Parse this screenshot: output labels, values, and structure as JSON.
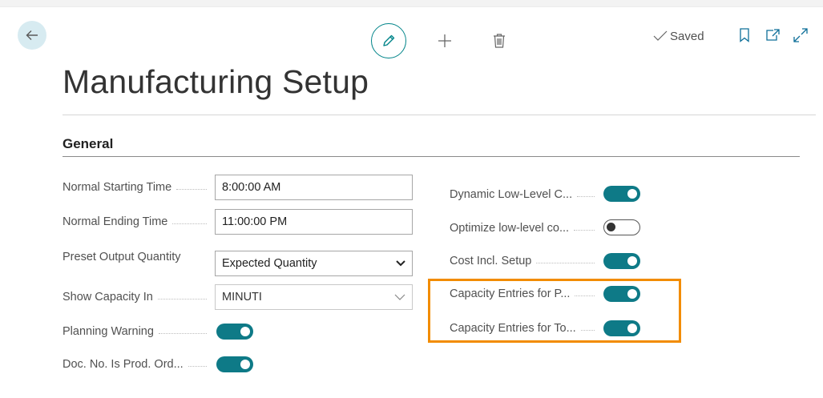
{
  "toolbar": {
    "saved_label": "Saved"
  },
  "page": {
    "title": "Manufacturing Setup"
  },
  "section": {
    "title": "General"
  },
  "left_fields": {
    "normal_starting_time": {
      "label": "Normal Starting Time",
      "value": "8:00:00 AM"
    },
    "normal_ending_time": {
      "label": "Normal Ending Time",
      "value": "11:00:00 PM"
    },
    "preset_output_quantity": {
      "label": "Preset Output Quantity",
      "value": "Expected Quantity"
    },
    "show_capacity_in": {
      "label": "Show Capacity In",
      "value": "MINUTI"
    },
    "planning_warning": {
      "label": "Planning Warning",
      "on": true
    },
    "doc_no_is_prod_ord": {
      "label": "Doc. No. Is Prod. Ord...",
      "on": true
    }
  },
  "right_fields": {
    "dynamic_low_level": {
      "label": "Dynamic Low-Level C...",
      "on": true
    },
    "optimize_low_level": {
      "label": "Optimize low-level co...",
      "on": false
    },
    "cost_incl_setup": {
      "label": "Cost Incl. Setup",
      "on": true
    },
    "capacity_entries_p": {
      "label": "Capacity Entries for P...",
      "on": true
    },
    "capacity_entries_to": {
      "label": "Capacity Entries for To...",
      "on": true
    }
  },
  "colors": {
    "accent": "#0e7a87",
    "highlight": "#f28c00"
  }
}
